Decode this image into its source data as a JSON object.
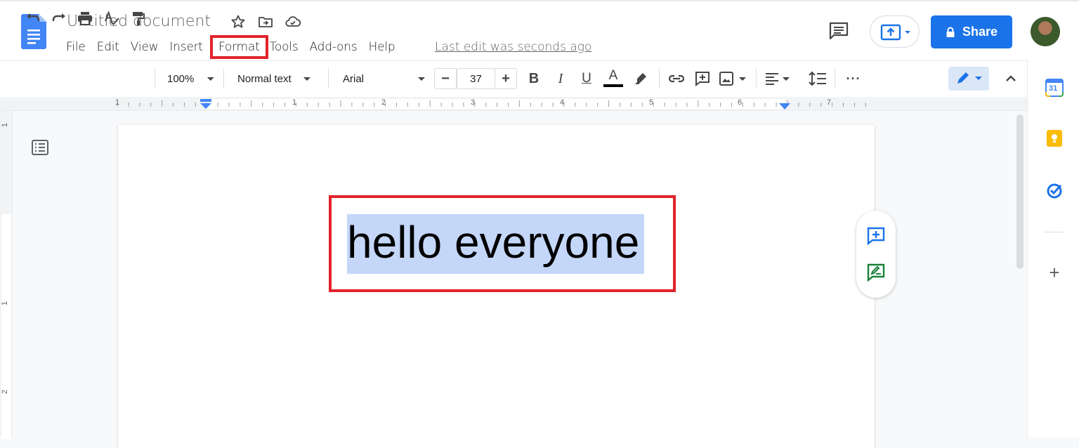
{
  "document": {
    "title": "Untitled document",
    "last_edit": "Last edit was seconds ago",
    "body_text": "hello everyone"
  },
  "menu": {
    "items": [
      "File",
      "Edit",
      "View",
      "Insert",
      "Format",
      "Tools",
      "Add-ons",
      "Help"
    ]
  },
  "header": {
    "share_label": "Share"
  },
  "toolbar": {
    "zoom": "100%",
    "style": "Normal text",
    "font": "Arial",
    "font_size": "37",
    "minus": "−",
    "plus": "+",
    "bold": "B",
    "italic": "I",
    "underline": "U",
    "text_color": "A",
    "more": "···"
  },
  "ruler": {
    "h_labels": [
      "1",
      "1",
      "2",
      "3",
      "4",
      "5",
      "6",
      "7"
    ],
    "v_labels": [
      "1",
      "1",
      "2"
    ]
  },
  "sidepanel": {
    "calendar_day": "31",
    "add": "+"
  },
  "colors": {
    "accent": "#1a73e8",
    "highlight_box": "#e2232b",
    "selection": "#c4d7f9",
    "keep": "#fbbc04"
  },
  "icons": [
    "docs-logo-icon",
    "star-icon",
    "move-to-folder-icon",
    "cloud-saved-icon",
    "comment-history-icon",
    "present-icon",
    "lock-icon",
    "undo-icon",
    "redo-icon",
    "print-icon",
    "spellcheck-icon",
    "paint-format-icon",
    "highlighter-icon",
    "link-icon",
    "add-comment-icon",
    "insert-image-icon",
    "align-icon",
    "line-spacing-icon",
    "edit-mode-icon",
    "collapse-icon",
    "outline-icon",
    "suggest-edit-icon",
    "calendar-icon",
    "keep-icon",
    "tasks-icon"
  ]
}
